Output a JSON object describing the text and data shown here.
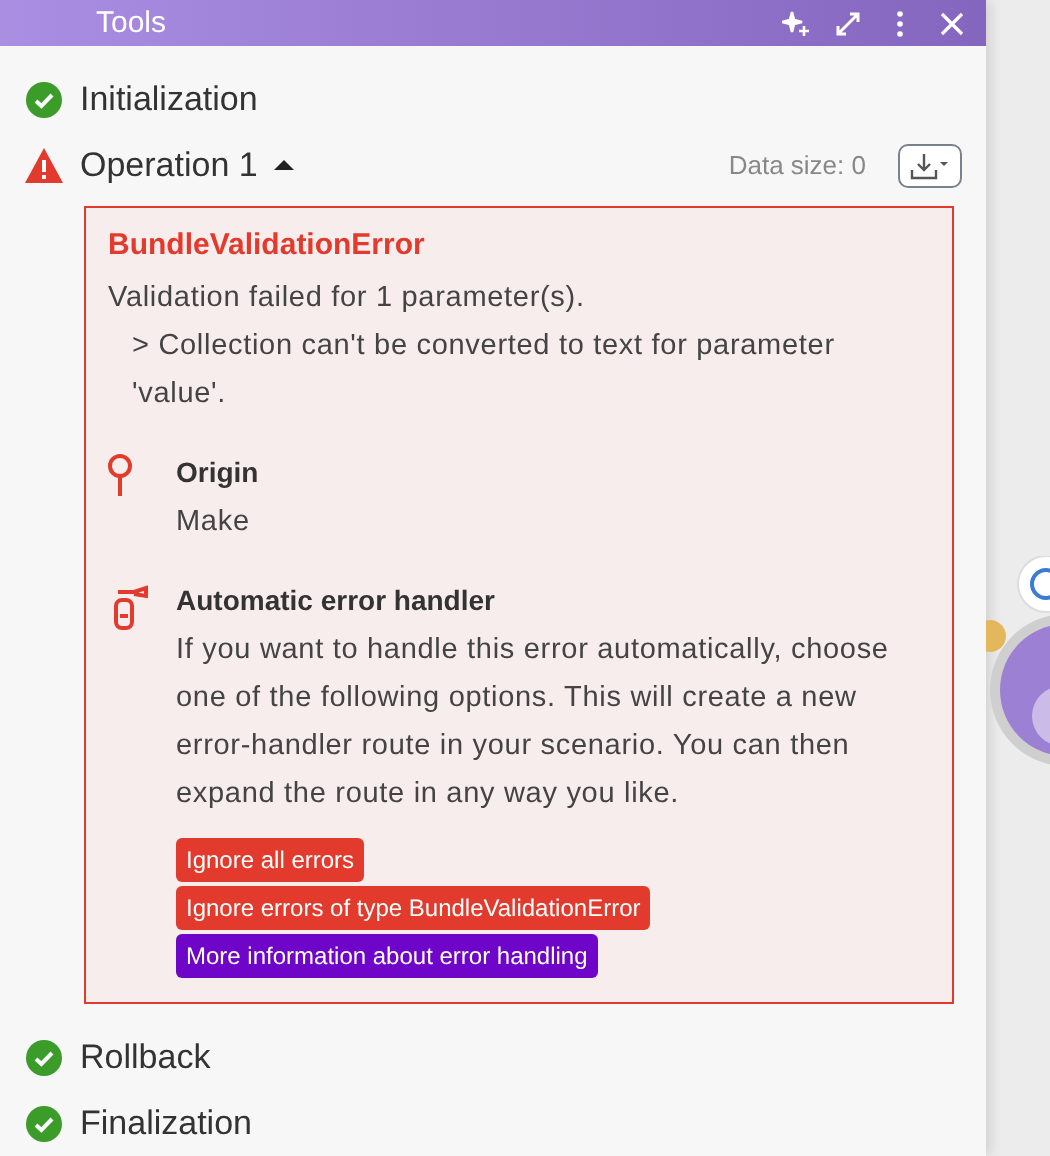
{
  "panel": {
    "title": "Tools"
  },
  "steps": [
    {
      "label": "Initialization",
      "kind": "success"
    },
    {
      "label": "Operation 1",
      "kind": "error",
      "expanded": true,
      "data_size": "Data size: 0"
    },
    {
      "label": "Rollback",
      "kind": "success"
    },
    {
      "label": "Finalization",
      "kind": "success"
    }
  ],
  "error": {
    "name": "BundleValidationError",
    "message": "Validation failed for 1 parameter(s).",
    "detail": "> Collection can't be converted to text for parameter 'value'.",
    "sections": [
      {
        "kind": "origin",
        "title": "Origin",
        "text": "Make"
      },
      {
        "kind": "handler",
        "title": "Automatic error handler",
        "text": "If you want to handle this error automatically, choose one of the following options. This will create a new error-handler route in your scenario. You can then expand the route in any way you like."
      }
    ],
    "actions": [
      {
        "label": "Ignore all errors",
        "kind": "danger"
      },
      {
        "label": "Ignore errors of type BundleValidationError",
        "kind": "danger"
      },
      {
        "label": "More information about error handling",
        "kind": "info"
      }
    ]
  }
}
